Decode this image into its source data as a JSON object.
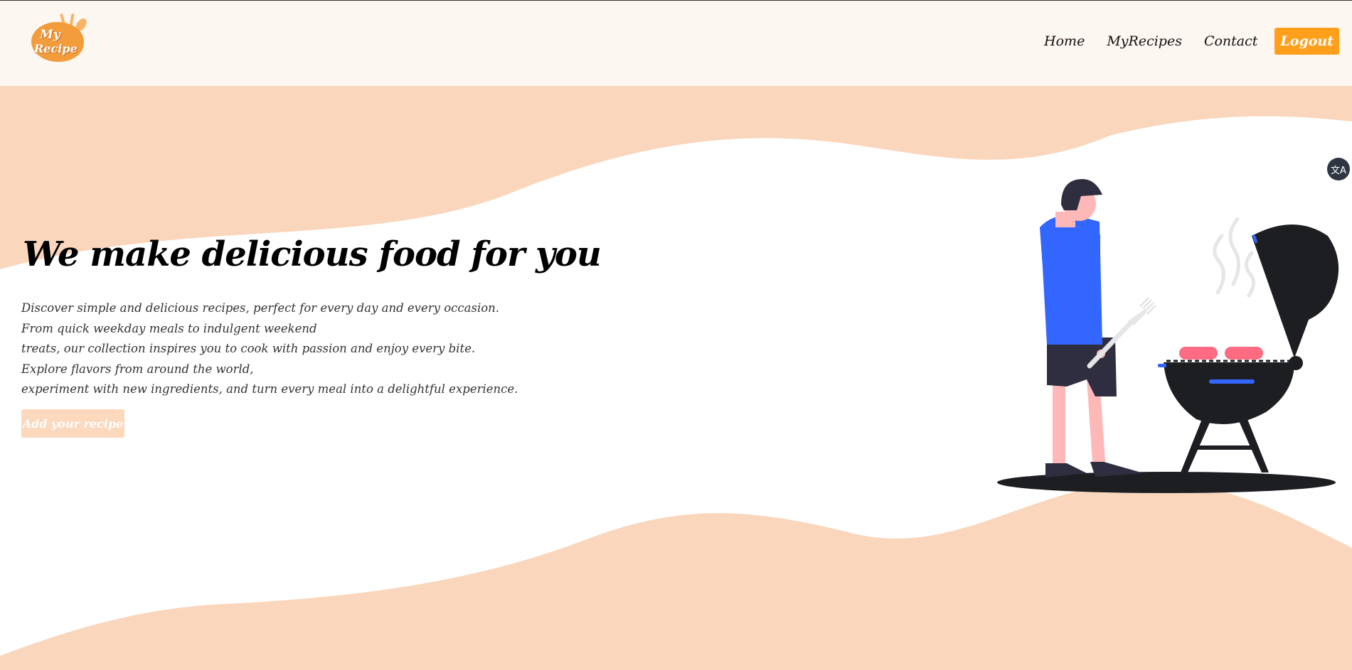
{
  "logo": {
    "line1": "My",
    "line2": "Recipe"
  },
  "nav": {
    "links": [
      "Home",
      "MyRecipes",
      "Contact"
    ],
    "logout_label": "Logout"
  },
  "hero": {
    "headline": "We make delicious food for you",
    "description_lines": [
      "Discover simple and delicious recipes, perfect for every day and every occasion.",
      "From quick weekday meals to indulgent weekend",
      "treats, our collection inspires you to cook with passion and enjoy every bite.",
      "Explore flavors from around the world,",
      "experiment with new ingredients, and turn every meal into a delightful experience."
    ],
    "cta_label": "Add your recipe"
  },
  "translate_widget": {
    "glyph": "文A",
    "icon": "translate-icon"
  },
  "colors": {
    "navbar_bg": "#fcf7f1",
    "wave": "#f9d6bc",
    "accent": "#ff9f1c",
    "cta_bg": "#fcd8bd",
    "shirt": "#3366ff",
    "grill": "#1d1e22",
    "sausage": "#ff6b81"
  }
}
